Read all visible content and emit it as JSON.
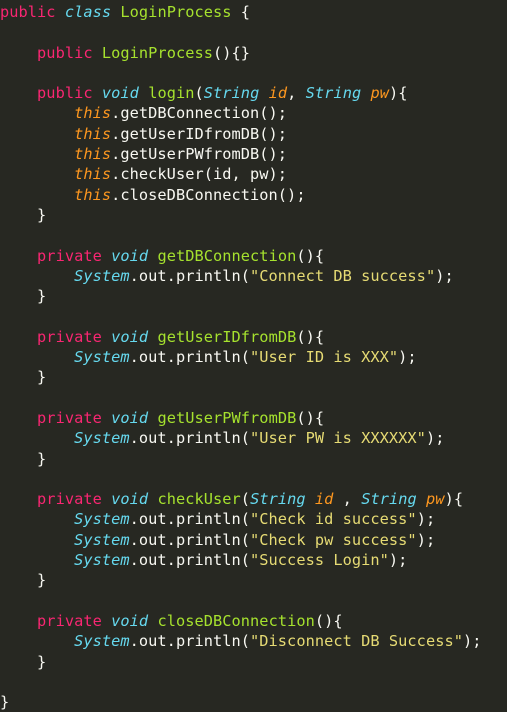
{
  "lines": [
    [
      [
        "kw",
        "public"
      ],
      [
        "pl",
        " "
      ],
      [
        "st",
        "class"
      ],
      [
        "pl",
        " "
      ],
      [
        "fn",
        "LoginProcess"
      ],
      [
        "pl",
        " {"
      ]
    ],
    [],
    [
      [
        "pl",
        "    "
      ],
      [
        "kw",
        "public"
      ],
      [
        "pl",
        " "
      ],
      [
        "fn",
        "LoginProcess"
      ],
      [
        "pl",
        "(){}"
      ]
    ],
    [],
    [
      [
        "pl",
        "    "
      ],
      [
        "kw",
        "public"
      ],
      [
        "pl",
        " "
      ],
      [
        "st",
        "void"
      ],
      [
        "pl",
        " "
      ],
      [
        "fn",
        "login"
      ],
      [
        "pl",
        "("
      ],
      [
        "st",
        "String"
      ],
      [
        "pl",
        " "
      ],
      [
        "pa",
        "id"
      ],
      [
        "pl",
        ", "
      ],
      [
        "st",
        "String"
      ],
      [
        "pl",
        " "
      ],
      [
        "pa",
        "pw"
      ],
      [
        "pl",
        "){"
      ]
    ],
    [
      [
        "pl",
        "        "
      ],
      [
        "th",
        "this"
      ],
      [
        "pl",
        ".getDBConnection();"
      ]
    ],
    [
      [
        "pl",
        "        "
      ],
      [
        "th",
        "this"
      ],
      [
        "pl",
        ".getUserIDfromDB();"
      ]
    ],
    [
      [
        "pl",
        "        "
      ],
      [
        "th",
        "this"
      ],
      [
        "pl",
        ".getUserPWfromDB();"
      ]
    ],
    [
      [
        "pl",
        "        "
      ],
      [
        "th",
        "this"
      ],
      [
        "pl",
        ".checkUser(id, pw);"
      ]
    ],
    [
      [
        "pl",
        "        "
      ],
      [
        "th",
        "this"
      ],
      [
        "pl",
        ".closeDBConnection();"
      ]
    ],
    [
      [
        "pl",
        "    }"
      ]
    ],
    [],
    [
      [
        "pl",
        "    "
      ],
      [
        "kw",
        "private"
      ],
      [
        "pl",
        " "
      ],
      [
        "st",
        "void"
      ],
      [
        "pl",
        " "
      ],
      [
        "fn",
        "getDBConnection"
      ],
      [
        "pl",
        "(){"
      ]
    ],
    [
      [
        "pl",
        "        "
      ],
      [
        "sy",
        "System"
      ],
      [
        "pl",
        ".out.println("
      ],
      [
        "sr",
        "\"Connect DB success\""
      ],
      [
        "pl",
        ");"
      ]
    ],
    [
      [
        "pl",
        "    }"
      ]
    ],
    [],
    [
      [
        "pl",
        "    "
      ],
      [
        "kw",
        "private"
      ],
      [
        "pl",
        " "
      ],
      [
        "st",
        "void"
      ],
      [
        "pl",
        " "
      ],
      [
        "fn",
        "getUserIDfromDB"
      ],
      [
        "pl",
        "(){"
      ]
    ],
    [
      [
        "pl",
        "        "
      ],
      [
        "sy",
        "System"
      ],
      [
        "pl",
        ".out.println("
      ],
      [
        "sr",
        "\"User ID is XXX\""
      ],
      [
        "pl",
        ");"
      ]
    ],
    [
      [
        "pl",
        "    }"
      ]
    ],
    [],
    [
      [
        "pl",
        "    "
      ],
      [
        "kw",
        "private"
      ],
      [
        "pl",
        " "
      ],
      [
        "st",
        "void"
      ],
      [
        "pl",
        " "
      ],
      [
        "fn",
        "getUserPWfromDB"
      ],
      [
        "pl",
        "(){"
      ]
    ],
    [
      [
        "pl",
        "        "
      ],
      [
        "sy",
        "System"
      ],
      [
        "pl",
        ".out.println("
      ],
      [
        "sr",
        "\"User PW is XXXXXX\""
      ],
      [
        "pl",
        ");"
      ]
    ],
    [
      [
        "pl",
        "    }"
      ]
    ],
    [],
    [
      [
        "pl",
        "    "
      ],
      [
        "kw",
        "private"
      ],
      [
        "pl",
        " "
      ],
      [
        "st",
        "void"
      ],
      [
        "pl",
        " "
      ],
      [
        "fn",
        "checkUser"
      ],
      [
        "pl",
        "("
      ],
      [
        "st",
        "String"
      ],
      [
        "pl",
        " "
      ],
      [
        "pa",
        "id"
      ],
      [
        "pl",
        " , "
      ],
      [
        "st",
        "String"
      ],
      [
        "pl",
        " "
      ],
      [
        "pa",
        "pw"
      ],
      [
        "pl",
        "){"
      ]
    ],
    [
      [
        "pl",
        "        "
      ],
      [
        "sy",
        "System"
      ],
      [
        "pl",
        ".out.println("
      ],
      [
        "sr",
        "\"Check id success\""
      ],
      [
        "pl",
        ");"
      ]
    ],
    [
      [
        "pl",
        "        "
      ],
      [
        "sy",
        "System"
      ],
      [
        "pl",
        ".out.println("
      ],
      [
        "sr",
        "\"Check pw success\""
      ],
      [
        "pl",
        ");"
      ]
    ],
    [
      [
        "pl",
        "        "
      ],
      [
        "sy",
        "System"
      ],
      [
        "pl",
        ".out.println("
      ],
      [
        "sr",
        "\"Success Login\""
      ],
      [
        "pl",
        ");"
      ]
    ],
    [
      [
        "pl",
        "    }"
      ]
    ],
    [],
    [
      [
        "pl",
        "    "
      ],
      [
        "kw",
        "private"
      ],
      [
        "pl",
        " "
      ],
      [
        "st",
        "void"
      ],
      [
        "pl",
        " "
      ],
      [
        "fn",
        "closeDBConnection"
      ],
      [
        "pl",
        "(){"
      ]
    ],
    [
      [
        "pl",
        "        "
      ],
      [
        "sy",
        "System"
      ],
      [
        "pl",
        ".out.println("
      ],
      [
        "sr",
        "\"Disconnect DB Success\""
      ],
      [
        "pl",
        ");"
      ]
    ],
    [
      [
        "pl",
        "    }"
      ]
    ],
    [],
    [
      [
        "pl",
        "}"
      ]
    ]
  ],
  "colors": {
    "background": "#272822",
    "keyword": "#f92672",
    "storage_type": "#66d9ef",
    "function_name": "#a6e22e",
    "parameter": "#fd971f",
    "string": "#e6db74",
    "plain": "#f8f8f2"
  }
}
